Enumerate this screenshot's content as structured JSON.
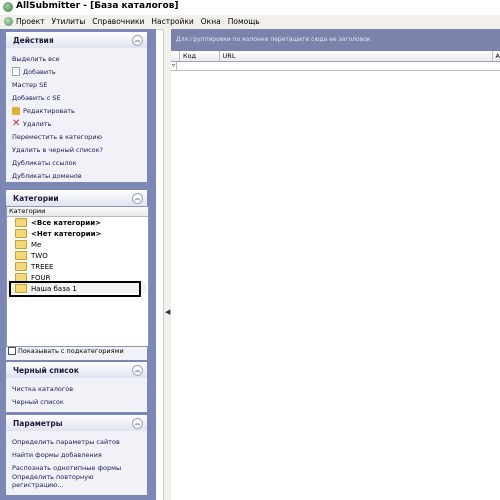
{
  "window": {
    "title": "AllSubmitter - [База каталогов]"
  },
  "menu": {
    "items": [
      "Проект",
      "Утилиты",
      "Справочники",
      "Настройки",
      "Окна",
      "Помощь"
    ]
  },
  "panels": {
    "actions": {
      "title": "Действия",
      "items": [
        "Выделить все",
        "Добавить",
        "Мастер SE",
        "Добавить с SE",
        "Редактировать",
        "Удалить",
        "Переместить в категорию",
        "Удалить в черный список?",
        "Дубликаты ссылок",
        "Дубликаты доменов"
      ]
    },
    "categories": {
      "title": "Категории",
      "column_header": "Категории",
      "items": [
        "<Все категории>",
        "<Нет категории>",
        "Me",
        "TWO",
        "TREEE",
        "FOUR",
        "Наша база 1"
      ],
      "show_subcategories": "Показывать с подкатегориями"
    },
    "blacklist": {
      "title": "Черный список",
      "items": [
        "Чистка каталогов",
        "Черный список"
      ]
    },
    "params": {
      "title": "Параметры",
      "items": [
        "Определить параметры сайтов",
        "Найти формы добавления",
        "Распознать однотипные формы",
        "Определить повторную регистрацию..."
      ]
    }
  },
  "grid": {
    "group_hint": "Для группировки по колонке перетащите сюда ее заголовок",
    "columns": [
      "Код",
      "URL",
      "A"
    ]
  },
  "colors": {
    "sidebar_bg": "#7b88b5",
    "group_panel_bg": "#7a84aa"
  }
}
